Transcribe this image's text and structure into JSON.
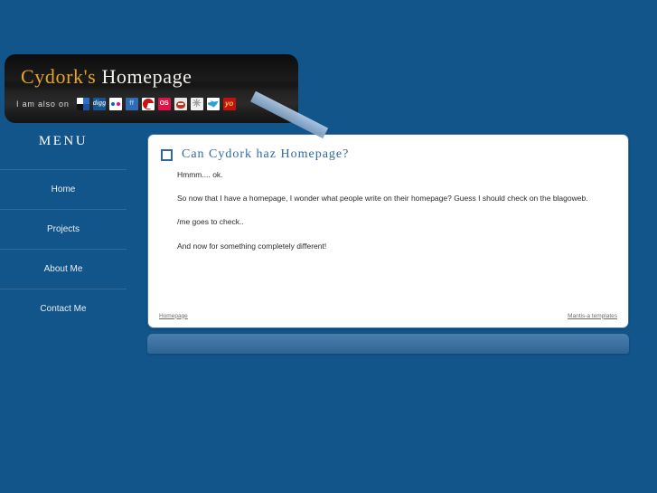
{
  "site": {
    "title_accent": "Cydork's",
    "title_plain": "Homepage",
    "also_on_label": "I am also on",
    "social_icons": [
      {
        "name": "delicious-icon",
        "label": ""
      },
      {
        "name": "digg-icon",
        "label": "digg"
      },
      {
        "name": "flickr-icon",
        "label": ""
      },
      {
        "name": "friendfeed-icon",
        "label": "ff"
      },
      {
        "name": "quake-icon",
        "label": ""
      },
      {
        "name": "os-icon",
        "label": "OS"
      },
      {
        "name": "reddit-icon",
        "label": ""
      },
      {
        "name": "asterisk-icon",
        "label": "✳"
      },
      {
        "name": "twitter-icon",
        "label": ""
      },
      {
        "name": "redmono-icon",
        "label": "yo"
      }
    ]
  },
  "sidebar": {
    "heading": "MENU",
    "items": [
      {
        "label": "Home"
      },
      {
        "label": "Projects"
      },
      {
        "label": "About Me"
      },
      {
        "label": "Contact Me"
      }
    ]
  },
  "post": {
    "title": "Can Cydork haz Homepage?",
    "paragraphs": [
      "Hmmm.... ok.",
      "So now that I have a homepage, I wonder what people write on their homepage? Guess I should check on the blagoweb.",
      "/me goes to check..",
      "And now for something completely different!"
    ],
    "footer_left": "Homepage",
    "footer_right": "Mantis-a templates"
  },
  "colors": {
    "page_background": "#12558a",
    "header_background": "#1a1a1a",
    "title_accent": "#e6a42b",
    "title_plain": "#f2f0ea",
    "post_title": "#2d68a5",
    "content_border": "#3a79ae",
    "bottom_panel": "#3f74a4",
    "tape": "#92b0d0"
  }
}
